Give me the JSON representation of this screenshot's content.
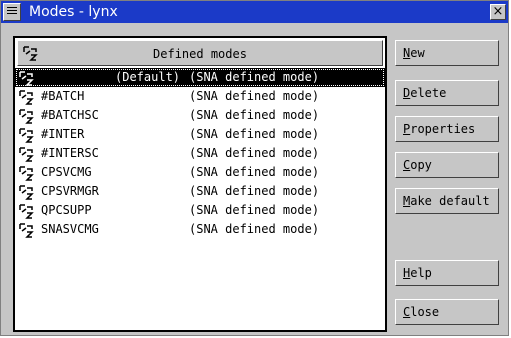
{
  "window": {
    "title": "Modes - lynx",
    "close_glyph": "×",
    "titlebar_color": "#1b3ac8"
  },
  "list": {
    "header": "Defined modes",
    "rows": [
      {
        "name": "",
        "default_label": "(Default)",
        "desc": "(SNA defined mode)",
        "selected": true
      },
      {
        "name": "#BATCH",
        "desc": "(SNA defined mode)"
      },
      {
        "name": "#BATCHSC",
        "desc": "(SNA defined mode)"
      },
      {
        "name": "#INTER",
        "desc": "(SNA defined mode)"
      },
      {
        "name": "#INTERSC",
        "desc": "(SNA defined mode)"
      },
      {
        "name": "CPSVCMG",
        "desc": "(SNA defined mode)"
      },
      {
        "name": "CPSVRMGR",
        "desc": "(SNA defined mode)"
      },
      {
        "name": "QPCSUPP",
        "desc": "(SNA defined mode)"
      },
      {
        "name": "SNASVCMG",
        "desc": "(SNA defined mode)"
      }
    ]
  },
  "buttons": {
    "new": {
      "label": "New",
      "mnemonic": "N",
      "rest": "ew"
    },
    "delete": {
      "label": "Delete",
      "mnemonic": "D",
      "rest": "elete"
    },
    "properties": {
      "label": "Properties",
      "mnemonic": "P",
      "rest": "roperties"
    },
    "copy": {
      "label": "Copy",
      "mnemonic": "C",
      "rest": "opy"
    },
    "make_default": {
      "label": "Make default",
      "mnemonic": "M",
      "rest": "ake default"
    },
    "help": {
      "label": "Help",
      "mnemonic": "H",
      "rest": "elp"
    },
    "close": {
      "label": "Close",
      "mnemonic": "C",
      "rest": "lose"
    }
  }
}
